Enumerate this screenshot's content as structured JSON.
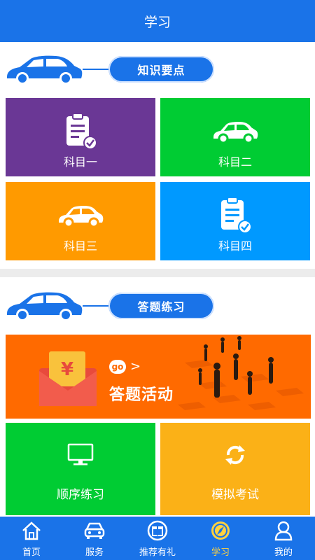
{
  "header": {
    "title": "学习"
  },
  "section1": {
    "title": "知识要点",
    "tiles": [
      {
        "label": "科目一",
        "color": "#6a3795",
        "icon": "clipboard-check-icon"
      },
      {
        "label": "科目二",
        "color": "#00cc33",
        "icon": "car-icon"
      },
      {
        "label": "科目三",
        "color": "#ff9a00",
        "icon": "car-icon"
      },
      {
        "label": "科目四",
        "color": "#0099ff",
        "icon": "clipboard-check-icon"
      }
    ]
  },
  "section2": {
    "title": "答题练习",
    "banner": {
      "go": "go",
      "arrow": ">",
      "title": "答题活动",
      "color": "#ff6a00",
      "envelope_symbol": "¥"
    },
    "tiles": [
      {
        "label": "顺序练习",
        "color": "#00cc33",
        "icon": "monitor-icon"
      },
      {
        "label": "模拟考试",
        "color": "#fbb117",
        "icon": "refresh-icon"
      }
    ]
  },
  "tabbar": {
    "items": [
      {
        "label": "首页",
        "icon": "home-icon"
      },
      {
        "label": "服务",
        "icon": "car-front-icon"
      },
      {
        "label": "推荐有礼",
        "icon": "gift-icon"
      },
      {
        "label": "学习",
        "icon": "compass-icon",
        "active": true
      },
      {
        "label": "我的",
        "icon": "user-icon"
      }
    ]
  },
  "colors": {
    "primary": "#1a73e8",
    "active_tab": "#ffd23f"
  }
}
